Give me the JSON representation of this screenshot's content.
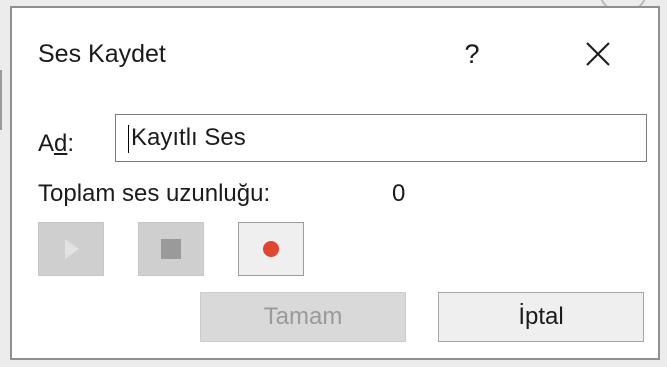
{
  "dialog": {
    "title": "Ses Kaydet",
    "help_label": "?",
    "close_icon": "close-icon"
  },
  "form": {
    "name_label_prefix": "A",
    "name_label_accel": "d",
    "name_label_suffix": ":",
    "name_value": "Kayıtlı Ses",
    "length_label": "Toplam ses uzunluğu:",
    "length_value": "0"
  },
  "controls": {
    "play_icon": "play-icon",
    "stop_icon": "stop-icon",
    "record_icon": "record-icon",
    "record_color": "#e0452f"
  },
  "buttons": {
    "ok_label": "Tamam",
    "cancel_label": "İptal"
  }
}
